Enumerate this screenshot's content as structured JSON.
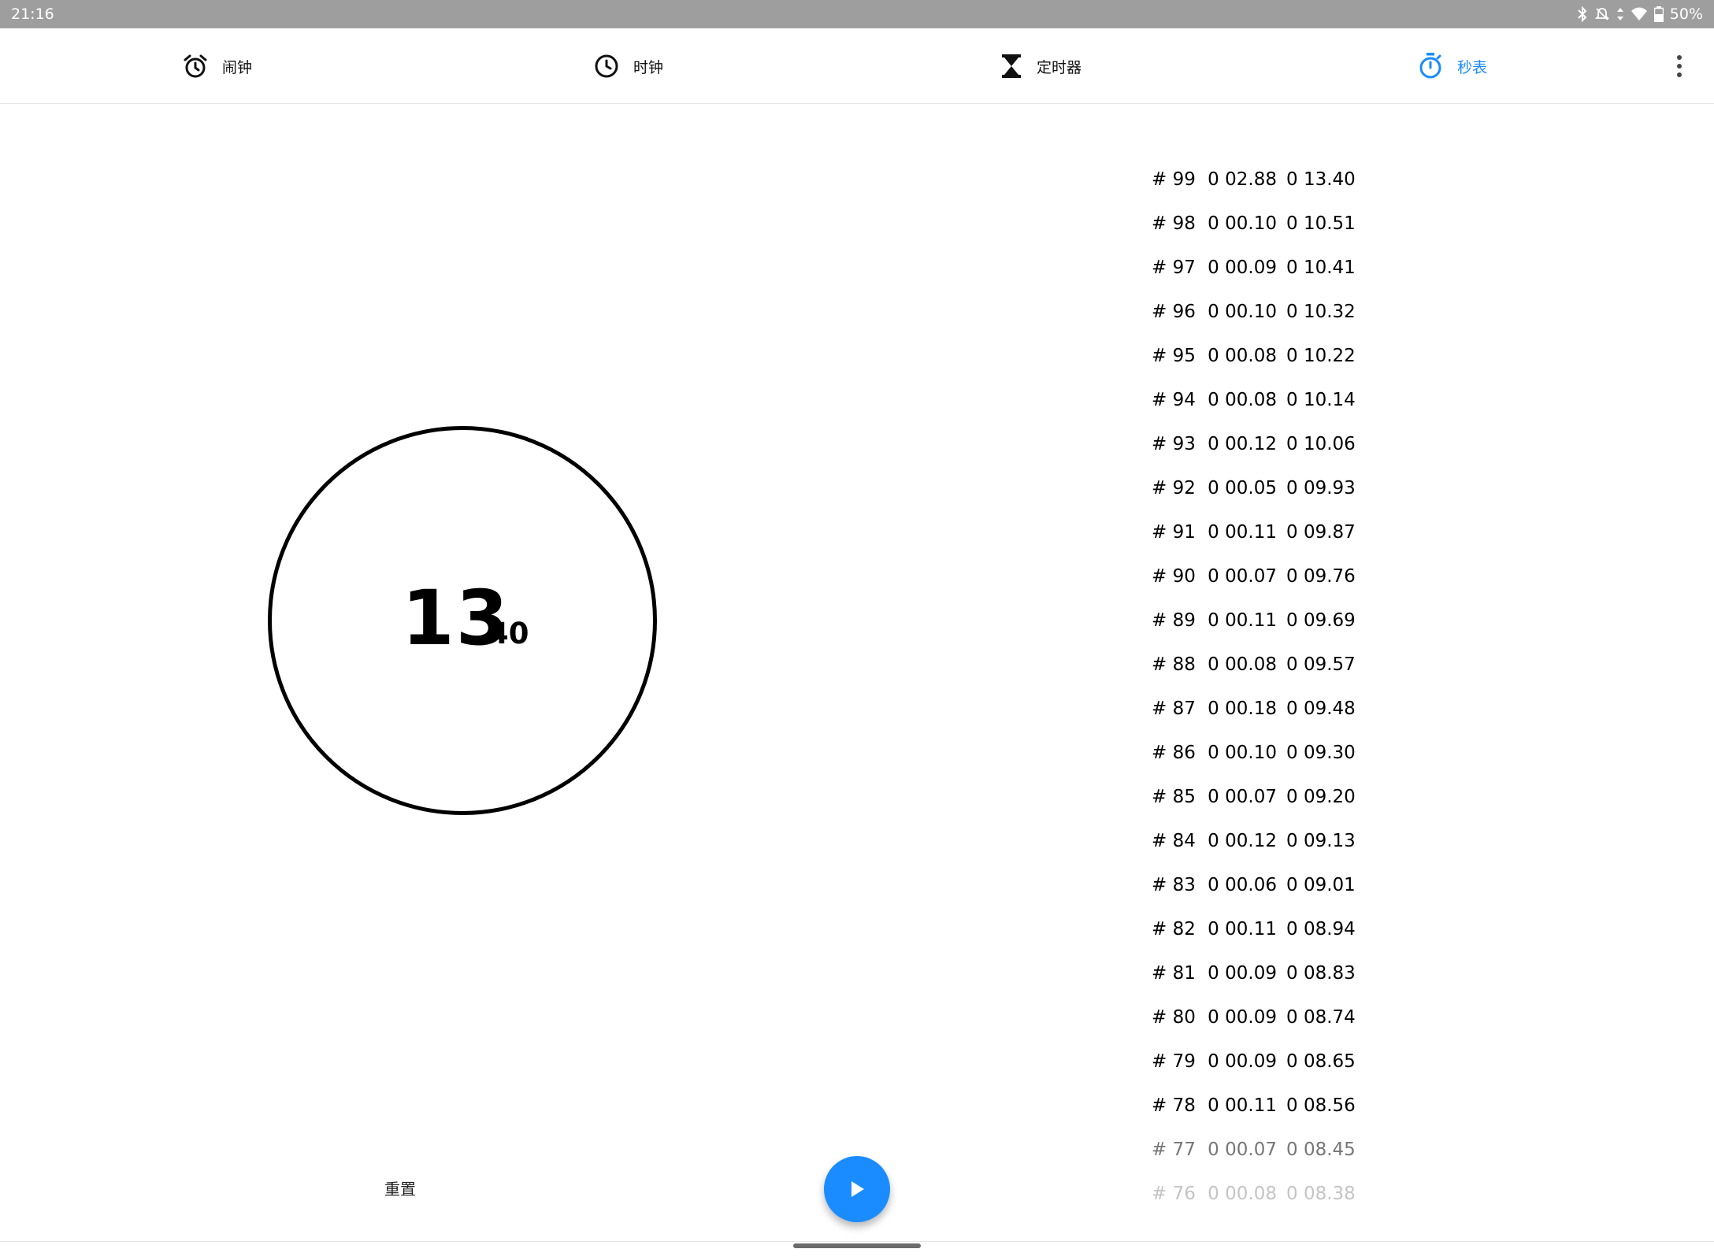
{
  "status_bar": {
    "time": "21:16",
    "battery": "50%"
  },
  "tabs": [
    {
      "label": "闹钟",
      "icon": "alarm-icon",
      "active": false
    },
    {
      "label": "时钟",
      "icon": "clock-icon",
      "active": false
    },
    {
      "label": "定时器",
      "icon": "hourglass-icon",
      "active": false
    },
    {
      "label": "秒表",
      "icon": "stopwatch-icon",
      "active": true
    }
  ],
  "colors": {
    "accent": "#1a8cff",
    "status_bar": "#9e9e9e"
  },
  "stopwatch": {
    "seconds": "13",
    "hundredths": "40"
  },
  "laps": [
    {
      "number": "# 99",
      "split": "0 02.88",
      "total": "0 13.40"
    },
    {
      "number": "# 98",
      "split": "0 00.10",
      "total": "0 10.51"
    },
    {
      "number": "# 97",
      "split": "0 00.09",
      "total": "0 10.41"
    },
    {
      "number": "# 96",
      "split": "0 00.10",
      "total": "0 10.32"
    },
    {
      "number": "# 95",
      "split": "0 00.08",
      "total": "0 10.22"
    },
    {
      "number": "# 94",
      "split": "0 00.08",
      "total": "0 10.14"
    },
    {
      "number": "# 93",
      "split": "0 00.12",
      "total": "0 10.06"
    },
    {
      "number": "# 92",
      "split": "0 00.05",
      "total": "0 09.93"
    },
    {
      "number": "# 91",
      "split": "0 00.11",
      "total": "0 09.87"
    },
    {
      "number": "# 90",
      "split": "0 00.07",
      "total": "0 09.76"
    },
    {
      "number": "# 89",
      "split": "0 00.11",
      "total": "0 09.69"
    },
    {
      "number": "# 88",
      "split": "0 00.08",
      "total": "0 09.57"
    },
    {
      "number": "# 87",
      "split": "0 00.18",
      "total": "0 09.48"
    },
    {
      "number": "# 86",
      "split": "0 00.10",
      "total": "0 09.30"
    },
    {
      "number": "# 85",
      "split": "0 00.07",
      "total": "0 09.20"
    },
    {
      "number": "# 84",
      "split": "0 00.12",
      "total": "0 09.13"
    },
    {
      "number": "# 83",
      "split": "0 00.06",
      "total": "0 09.01"
    },
    {
      "number": "# 82",
      "split": "0 00.11",
      "total": "0 08.94"
    },
    {
      "number": "# 81",
      "split": "0 00.09",
      "total": "0 08.83"
    },
    {
      "number": "# 80",
      "split": "0 00.09",
      "total": "0 08.74"
    },
    {
      "number": "# 79",
      "split": "0 00.09",
      "total": "0 08.65"
    },
    {
      "number": "# 78",
      "split": "0 00.11",
      "total": "0 08.56"
    },
    {
      "number": "# 77",
      "split": "0 00.07",
      "total": "0 08.45"
    },
    {
      "number": "# 76",
      "split": "0 00.08",
      "total": "0 08.38"
    }
  ],
  "controls": {
    "reset_label": "重置",
    "fab_icon": "play-icon"
  }
}
